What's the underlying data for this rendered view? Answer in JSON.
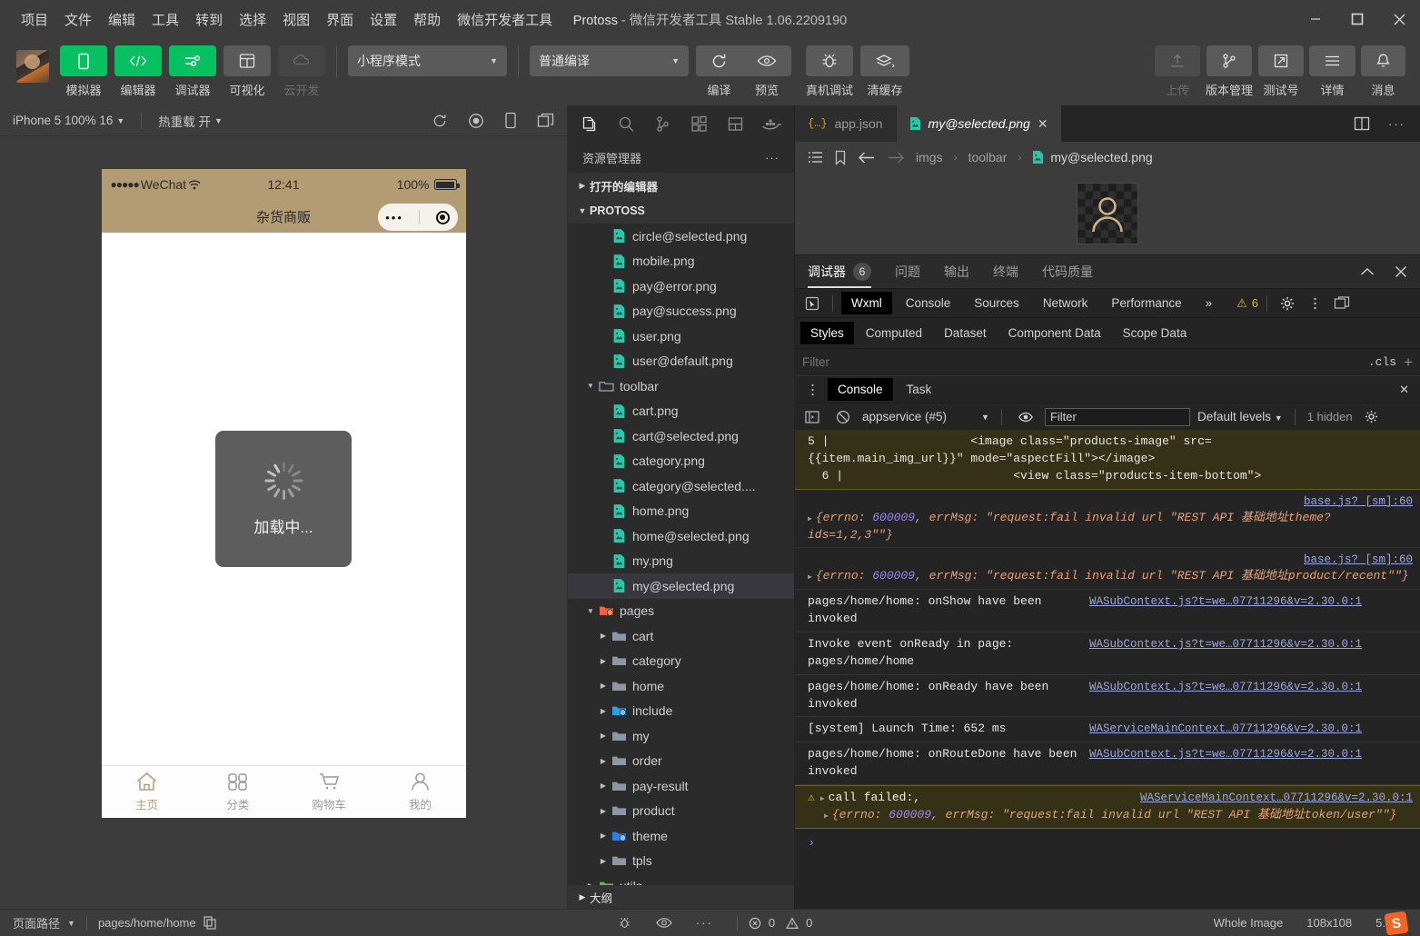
{
  "window": {
    "title_app": "Protoss",
    "title_rest": "微信开发者工具 Stable 1.06.2209190",
    "menu": [
      "项目",
      "文件",
      "编辑",
      "工具",
      "转到",
      "选择",
      "视图",
      "界面",
      "设置",
      "帮助",
      "微信开发者工具"
    ]
  },
  "toolbar": {
    "left_buttons": [
      {
        "label": "模拟器",
        "icon": "phone-icon",
        "state": "active"
      },
      {
        "label": "编辑器",
        "icon": "code-icon",
        "state": "active"
      },
      {
        "label": "调试器",
        "icon": "sliders-icon",
        "state": "active"
      },
      {
        "label": "可视化",
        "icon": "layout-icon",
        "state": "normal"
      },
      {
        "label": "云开发",
        "icon": "cloud-icon",
        "state": "disabled"
      }
    ],
    "mode_select": "小程序模式",
    "compile_select": "普通编译",
    "center_buttons": [
      {
        "label": "编译",
        "icon": "refresh-icon"
      },
      {
        "label": "预览",
        "icon": "eye-icon"
      },
      {
        "label": "真机调试",
        "icon": "bug-icon"
      },
      {
        "label": "清缓存",
        "icon": "layers-icon"
      }
    ],
    "right_buttons": [
      {
        "label": "上传",
        "icon": "upload-icon",
        "state": "disabled"
      },
      {
        "label": "版本管理",
        "icon": "branch-icon",
        "state": "normal"
      },
      {
        "label": "测试号",
        "icon": "external-link-icon",
        "state": "normal"
      },
      {
        "label": "详情",
        "icon": "menu-icon",
        "state": "normal"
      },
      {
        "label": "消息",
        "icon": "bell-icon",
        "state": "normal"
      }
    ]
  },
  "simulator": {
    "device": "iPhone 5 100% 16",
    "hot_reload": "热重载 开",
    "icons": [
      "refresh-icon",
      "record-icon",
      "mobile-icon",
      "window-icon"
    ],
    "status": {
      "carrier": "WeChat",
      "dots": "●●●●●",
      "time": "12:41",
      "battery_pct": "100%"
    },
    "nav_title": "杂货商贩",
    "loading_text": "加载中...",
    "tabs": [
      {
        "label": "主页",
        "icon": "home-icon",
        "active": true
      },
      {
        "label": "分类",
        "icon": "category-icon",
        "active": false
      },
      {
        "label": "购物车",
        "icon": "cart-icon",
        "active": false
      },
      {
        "label": "我的",
        "icon": "user-icon",
        "active": false
      }
    ]
  },
  "explorer": {
    "activity_icons": [
      "files-icon",
      "search-icon",
      "source-control-icon",
      "extensions-icon",
      "layout-icon",
      "docker-icon"
    ],
    "title": "资源管理器",
    "more": "···",
    "sections": [
      {
        "label": "打开的编辑器",
        "expanded": false
      },
      {
        "label": "PROTOSS",
        "expanded": true
      }
    ],
    "tree": [
      {
        "label": "circle@selected.png",
        "type": "image",
        "depth": 3,
        "expandable": false,
        "selected": false
      },
      {
        "label": "mobile.png",
        "type": "image",
        "depth": 3,
        "expandable": false,
        "selected": false
      },
      {
        "label": "pay@error.png",
        "type": "image",
        "depth": 3,
        "expandable": false,
        "selected": false
      },
      {
        "label": "pay@success.png",
        "type": "image",
        "depth": 3,
        "expandable": false,
        "selected": false
      },
      {
        "label": "user.png",
        "type": "image",
        "depth": 3,
        "expandable": false,
        "selected": false
      },
      {
        "label": "user@default.png",
        "type": "image",
        "depth": 3,
        "expandable": false,
        "selected": false
      },
      {
        "label": "toolbar",
        "type": "folder-open",
        "depth": 2,
        "expandable": true,
        "expanded": true,
        "selected": false
      },
      {
        "label": "cart.png",
        "type": "image",
        "depth": 3,
        "expandable": false,
        "selected": false
      },
      {
        "label": "cart@selected.png",
        "type": "image",
        "depth": 3,
        "expandable": false,
        "selected": false
      },
      {
        "label": "category.png",
        "type": "image",
        "depth": 3,
        "expandable": false,
        "selected": false
      },
      {
        "label": "category@selected....",
        "type": "image",
        "depth": 3,
        "expandable": false,
        "selected": false
      },
      {
        "label": "home.png",
        "type": "image",
        "depth": 3,
        "expandable": false,
        "selected": false
      },
      {
        "label": "home@selected.png",
        "type": "image",
        "depth": 3,
        "expandable": false,
        "selected": false
      },
      {
        "label": "my.png",
        "type": "image",
        "depth": 3,
        "expandable": false,
        "selected": false
      },
      {
        "label": "my@selected.png",
        "type": "image",
        "depth": 3,
        "expandable": false,
        "selected": true
      },
      {
        "label": "pages",
        "type": "folder-pages",
        "depth": 2,
        "expandable": true,
        "expanded": true,
        "selected": false
      },
      {
        "label": "cart",
        "type": "folder",
        "depth": 3,
        "expandable": true,
        "expanded": false,
        "selected": false
      },
      {
        "label": "category",
        "type": "folder",
        "depth": 3,
        "expandable": true,
        "expanded": false,
        "selected": false
      },
      {
        "label": "home",
        "type": "folder",
        "depth": 3,
        "expandable": true,
        "expanded": false,
        "selected": false
      },
      {
        "label": "include",
        "type": "folder-blue",
        "depth": 3,
        "expandable": true,
        "expanded": false,
        "selected": false
      },
      {
        "label": "my",
        "type": "folder",
        "depth": 3,
        "expandable": true,
        "expanded": false,
        "selected": false
      },
      {
        "label": "order",
        "type": "folder",
        "depth": 3,
        "expandable": true,
        "expanded": false,
        "selected": false
      },
      {
        "label": "pay-result",
        "type": "folder",
        "depth": 3,
        "expandable": true,
        "expanded": false,
        "selected": false
      },
      {
        "label": "product",
        "type": "folder",
        "depth": 3,
        "expandable": true,
        "expanded": false,
        "selected": false
      },
      {
        "label": "theme",
        "type": "folder-blue2",
        "depth": 3,
        "expandable": true,
        "expanded": false,
        "selected": false
      },
      {
        "label": "tpls",
        "type": "folder",
        "depth": 3,
        "expandable": true,
        "expanded": false,
        "selected": false
      },
      {
        "label": "utils",
        "type": "folder-green",
        "depth": 2,
        "expandable": true,
        "expanded": false,
        "selected": false
      }
    ],
    "outline": "大纲"
  },
  "editor": {
    "tabs": [
      {
        "label": "app.json",
        "icon": "json-icon",
        "active": false,
        "closable": false
      },
      {
        "label": "my@selected.png",
        "icon": "image-icon",
        "active": true,
        "closable": true
      }
    ],
    "tabs_right_icons": [
      "split-editor-icon",
      "more-icon"
    ],
    "breadcrumb_icons": [
      "outline-icon",
      "bookmark-icon",
      "back-icon",
      "forward-icon"
    ],
    "breadcrumb": [
      "imgs",
      "toolbar",
      "my@selected.png"
    ],
    "preview_alt": "my@selected.png preview"
  },
  "debugger": {
    "tabs": [
      {
        "label": "调试器",
        "badge": "6",
        "active": true
      },
      {
        "label": "问题",
        "badge": "",
        "active": false
      },
      {
        "label": "输出",
        "badge": "",
        "active": false
      },
      {
        "label": "终端",
        "badge": "",
        "active": false
      },
      {
        "label": "代码质量",
        "badge": "",
        "active": false
      }
    ],
    "panel_icons": [
      "collapse-icon",
      "close-icon"
    ],
    "devtools_tabs": [
      "Wxml",
      "Console",
      "Sources",
      "Network",
      "Performance"
    ],
    "devtools_active": "Wxml",
    "devtools_overflow": "»",
    "warning_count": "6",
    "devtools_right_icons": [
      "gear-icon",
      "dots-vertical-icon",
      "dock-icon"
    ],
    "style_tabs": [
      "Styles",
      "Computed",
      "Dataset",
      "Component Data",
      "Scope Data"
    ],
    "style_active": "Styles",
    "style_filter_placeholder": "Filter",
    "cls_label": ".cls",
    "plus_label": "+",
    "console_tabs": [
      "Console",
      "Task"
    ],
    "console_active": "Console",
    "context": "appservice (#5)",
    "console_filter_placeholder": "Filter",
    "levels": "Default levels",
    "hidden": "1 hidden",
    "messages": [
      {
        "kind": "code",
        "lines": [
          "5 |                    <image class=\"products-image\" src=",
          "{{item.main_img_url}}\" mode=\"aspectFill\"></image>",
          "  6 |                        <view class=\"products-item-bottom\">"
        ],
        "source": ""
      },
      {
        "kind": "error-obj",
        "prefix": "{errno: ",
        "errno": "600009",
        "mid": ", errMsg: ",
        "msg": "\"request:fail invalid url \"REST API 基础地址theme?ids=1,2,3\"\"}",
        "source": "base.js? [sm]:60"
      },
      {
        "kind": "error-obj",
        "prefix": "{errno: ",
        "errno": "600009",
        "mid": ", errMsg: ",
        "msg": "\"request:fail invalid url \"REST API 基础地址product/recent\"\"}",
        "source": "base.js? [sm]:60"
      },
      {
        "kind": "info",
        "text": "pages/home/home: onShow have been invoked",
        "source": "WASubContext.js?t=we…07711296&v=2.30.0:1"
      },
      {
        "kind": "info",
        "text": "Invoke event onReady in page: pages/home/home",
        "source": "WASubContext.js?t=we…07711296&v=2.30.0:1"
      },
      {
        "kind": "info",
        "text": "pages/home/home: onReady have been invoked",
        "source": "WASubContext.js?t=we…07711296&v=2.30.0:1"
      },
      {
        "kind": "info",
        "text": "[system] Launch Time: 652 ms",
        "source": "WAServiceMainContext…07711296&v=2.30.0:1"
      },
      {
        "kind": "info",
        "text": "pages/home/home: onRouteDone have been invoked",
        "source": "WASubContext.js?t=we…07711296&v=2.30.0:1"
      },
      {
        "kind": "warn",
        "text": "call failed:,",
        "detail_prefix": "{errno: ",
        "errno": "600009",
        "mid": ", errMsg: ",
        "detail_msg": "\"request:fail invalid url \"REST API 基础地址token/user\"\"}",
        "source": "WAServiceMainContext…07711296&v=2.30.0:1"
      }
    ],
    "prompt": "›"
  },
  "status_bar": {
    "page_path_label": "页面路径",
    "page_path": "pages/home/home",
    "icons": [
      "bug-icon",
      "eye-icon",
      "more-icon"
    ],
    "errors": "0",
    "warnings": "0",
    "image_scope": "Whole Image",
    "image_size": "108x108",
    "image_weight": "5.",
    "ime": "S"
  },
  "colors": {
    "accent_green": "#07c160",
    "panel_bg": "#2b2b2b",
    "chrome_bg": "#3c3c3c",
    "image_icon": "#2fc4a8",
    "status_tan": "#b39c74",
    "warn": "#f0b429"
  }
}
